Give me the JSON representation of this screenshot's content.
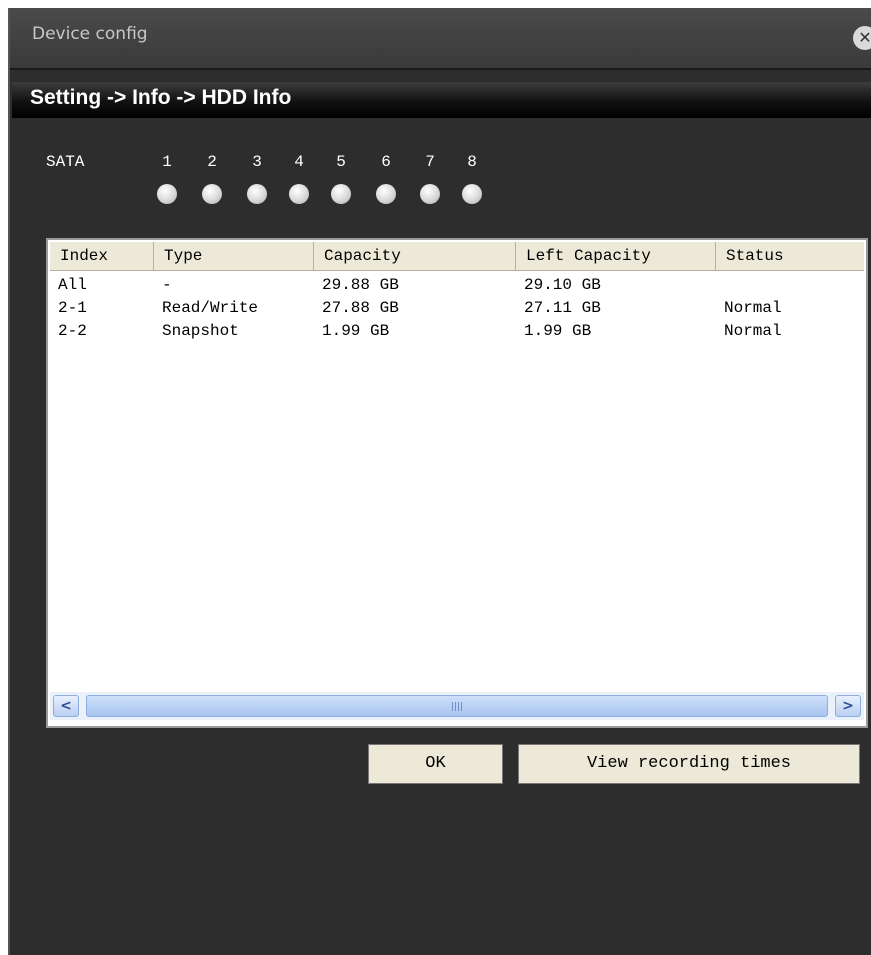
{
  "window": {
    "title": "Device config"
  },
  "breadcrumb": "Setting -> Info -> HDD Info",
  "sata": {
    "label": "SATA",
    "ports": [
      "1",
      "2",
      "3",
      "4",
      "5",
      "6",
      "7",
      "8"
    ]
  },
  "table": {
    "columns": [
      "Index",
      "Type",
      "Capacity",
      "Left Capacity",
      "Status"
    ],
    "rows": [
      [
        "All",
        "-",
        "29.88 GB",
        "29.10 GB",
        ""
      ],
      [
        "2-1",
        "Read/Write",
        "27.88 GB",
        "27.11 GB",
        "Normal"
      ],
      [
        "2-2",
        "Snapshot",
        "1.99 GB",
        "1.99 GB",
        "Normal"
      ]
    ]
  },
  "buttons": {
    "ok": "OK",
    "view_recording_times": "View recording times"
  },
  "icons": {
    "close": "close-icon",
    "scroll_left": "chevron-left-icon",
    "scroll_right": "chevron-right-icon"
  }
}
